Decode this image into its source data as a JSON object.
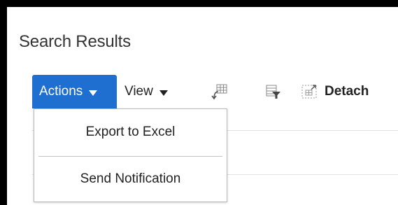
{
  "page": {
    "title": "Search Results"
  },
  "toolbar": {
    "actions_label": "Actions",
    "view_label": "View",
    "freeze_icon": "freeze-columns-icon",
    "filter_icon": "query-by-example-icon",
    "detach_icon": "detach-icon",
    "detach_label": "Detach"
  },
  "actions_menu": {
    "items": [
      {
        "label": "Export to Excel"
      },
      {
        "label": "Send Notification"
      }
    ]
  },
  "colors": {
    "accent": "#1e6fd0",
    "frame_border": "#000000",
    "text": "#333333"
  }
}
